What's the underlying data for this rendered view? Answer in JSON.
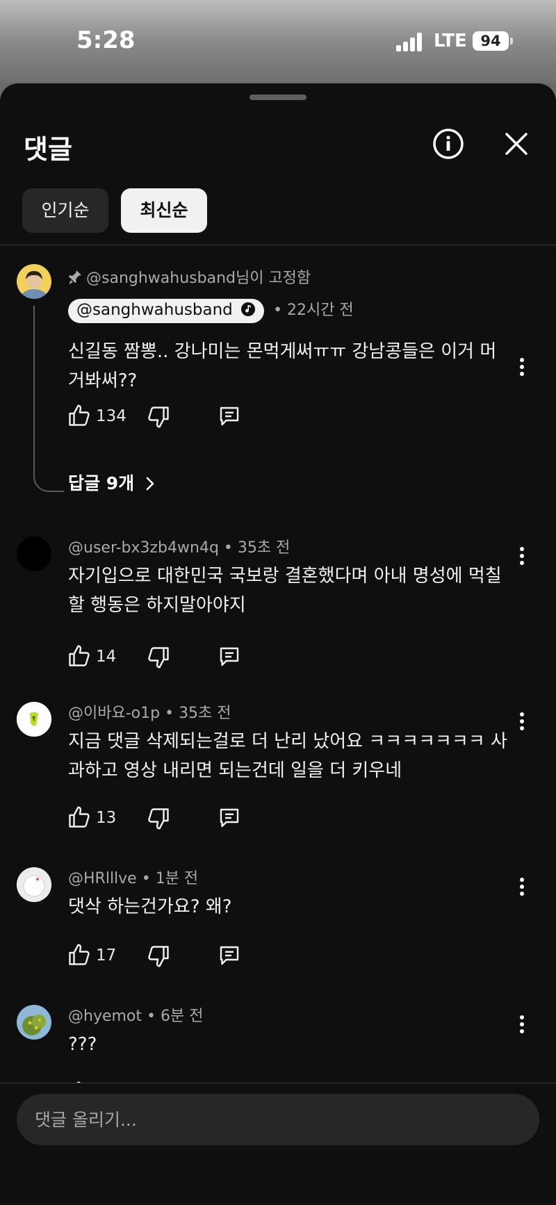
{
  "status_bar": {
    "time": "5:28",
    "network": "LTE",
    "battery": "94"
  },
  "header": {
    "title": "댓글",
    "info_icon": "info-icon",
    "close_icon": "close-icon"
  },
  "sort_chips": [
    {
      "label": "인기순",
      "selected": false
    },
    {
      "label": "최신순",
      "selected": true
    }
  ],
  "pinned": {
    "pinned_label": "@sanghwahusband님이 고정함",
    "author": "@sanghwahusband",
    "time": "22시간 전",
    "text": "신길동 짬뽕.. 강나미는 몬먹게써ㅠㅠ 강남콩들은 이거 머거봐써??",
    "likes": "134",
    "replies_label": "답글 9개"
  },
  "comments": [
    {
      "author": "@user-bx3zb4wn4q",
      "time": "35초 전",
      "text": "자기입으로 대한민국 국보랑 결혼했다며 아내 명성에 먹칠할 행동은 하지말아야지",
      "likes": "14"
    },
    {
      "author": "@이바요-o1p",
      "time": "35초 전",
      "text": "지금 댓글 삭제되는걸로 더 난리 났어요 ㅋㅋㅋㅋㅋㅋㅋ 사과하고 영상 내리면 되는건데 일을 더 키우네",
      "likes": "13"
    },
    {
      "author": "@HRlllve",
      "time": "1분 전",
      "text": "댓삭 하는건가요? 왜?",
      "likes": "17"
    },
    {
      "author": "@hyemot",
      "time": "6분 전",
      "text": "???",
      "likes": ""
    }
  ],
  "composer": {
    "placeholder": "댓글 올리기..."
  },
  "colors": {
    "background": "#0f0f0f",
    "chip_bg": "#272727",
    "text": "#f1f1f1",
    "meta": "#aaaaaa"
  }
}
